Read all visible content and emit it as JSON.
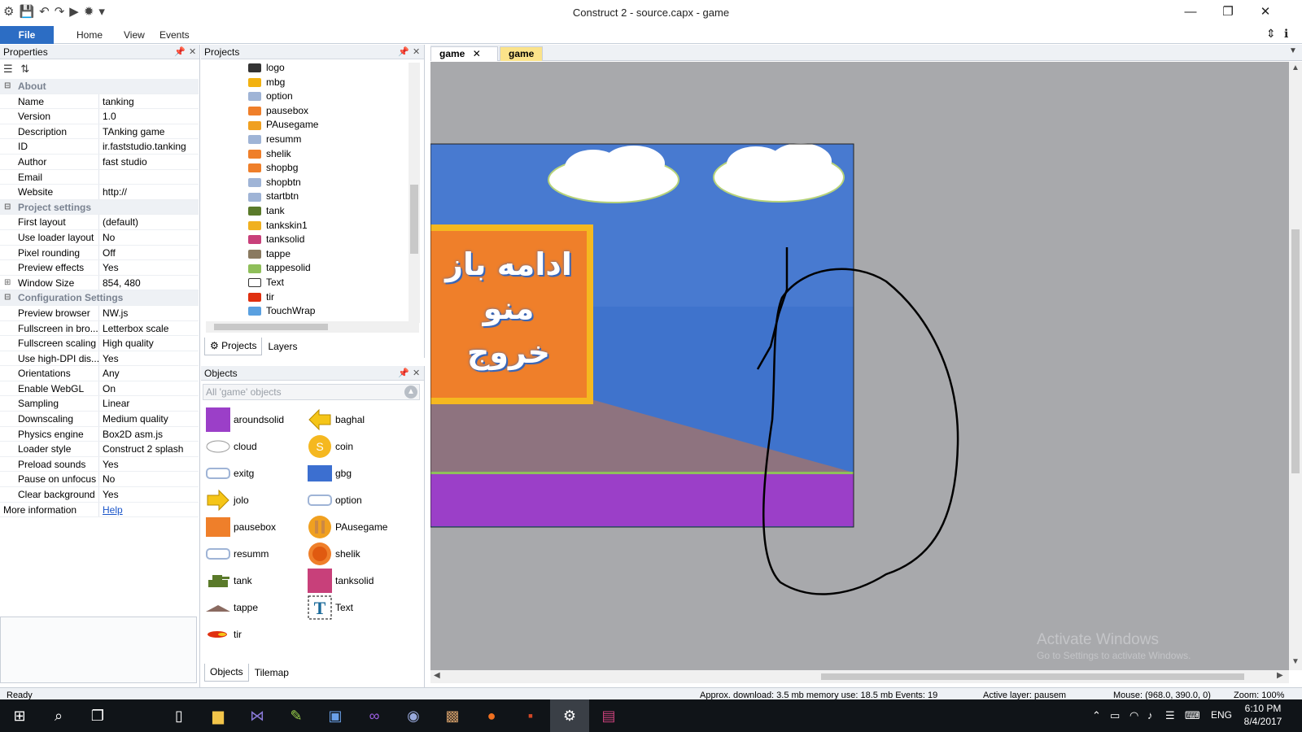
{
  "window": {
    "title": "Construct 2 - source.capx - game",
    "minimize": "—",
    "maximize": "❐",
    "close": "✕"
  },
  "quick_access": [
    "⚙",
    "💾",
    "↶",
    "↷",
    "▶",
    "✹",
    "▾"
  ],
  "ribbon": {
    "tabs": [
      "File",
      "Home",
      "View",
      "Events"
    ],
    "collapse": "⇕",
    "help": "ℹ"
  },
  "properties": {
    "title": "Properties",
    "sections": [
      {
        "label": "About",
        "rows": [
          {
            "k": "Name",
            "v": "tanking"
          },
          {
            "k": "Version",
            "v": "1.0"
          },
          {
            "k": "Description",
            "v": "TAnking game"
          },
          {
            "k": "ID",
            "v": "ir.faststudio.tanking"
          },
          {
            "k": "Author",
            "v": "fast studio"
          },
          {
            "k": "Email",
            "v": ""
          },
          {
            "k": "Website",
            "v": "http://"
          }
        ]
      },
      {
        "label": "Project settings",
        "rows": [
          {
            "k": "First layout",
            "v": "(default)"
          },
          {
            "k": "Use loader layout",
            "v": "No"
          },
          {
            "k": "Pixel rounding",
            "v": "Off"
          },
          {
            "k": "Preview effects",
            "v": "Yes"
          },
          {
            "k": "Window Size",
            "v": "854, 480"
          }
        ]
      },
      {
        "label": "Configuration Settings",
        "rows": [
          {
            "k": "Preview browser",
            "v": "NW.js"
          },
          {
            "k": "Fullscreen in bro...",
            "v": "Letterbox scale"
          },
          {
            "k": "Fullscreen scaling",
            "v": "High quality"
          },
          {
            "k": "Use high-DPI dis...",
            "v": "Yes"
          },
          {
            "k": "Orientations",
            "v": "Any"
          },
          {
            "k": "Enable WebGL",
            "v": "On"
          },
          {
            "k": "Sampling",
            "v": "Linear"
          },
          {
            "k": "Downscaling",
            "v": "Medium quality"
          },
          {
            "k": "Physics engine",
            "v": "Box2D asm.js"
          },
          {
            "k": "Loader style",
            "v": "Construct 2 splash"
          },
          {
            "k": "Preload sounds",
            "v": "Yes"
          },
          {
            "k": "Pause on unfocus",
            "v": "No"
          },
          {
            "k": "Clear background",
            "v": "Yes"
          }
        ]
      }
    ],
    "more_info": {
      "k": "More information",
      "v": "Help"
    }
  },
  "projects": {
    "title": "Projects",
    "items": [
      {
        "label": "logo",
        "color": "#333333"
      },
      {
        "label": "mbg",
        "color": "#f2b211"
      },
      {
        "label": "option",
        "color": "#9fb4d6"
      },
      {
        "label": "pausebox",
        "color": "#ef7f2a"
      },
      {
        "label": "PAusegame",
        "color": "#f0a020"
      },
      {
        "label": "resumm",
        "color": "#9fb4d6"
      },
      {
        "label": "shelik",
        "color": "#ef7f2a"
      },
      {
        "label": "shopbg",
        "color": "#ef7f2a"
      },
      {
        "label": "shopbtn",
        "color": "#9fb4d6"
      },
      {
        "label": "startbtn",
        "color": "#9fb4d6"
      },
      {
        "label": "tank",
        "color": "#5a7a2a"
      },
      {
        "label": "tankskin1",
        "color": "#f0b020"
      },
      {
        "label": "tanksolid",
        "color": "#c8407a"
      },
      {
        "label": "tappe",
        "color": "#8a7a60"
      },
      {
        "label": "tappesolid",
        "color": "#8fbf5a"
      },
      {
        "label": "Text",
        "color": "#ffffff"
      },
      {
        "label": "tir",
        "color": "#e03010"
      },
      {
        "label": "TouchWrap",
        "color": "#5aa0e0"
      }
    ],
    "tabs": [
      "Projects",
      "Layers"
    ]
  },
  "objects": {
    "title": "Objects",
    "filter": "All 'game' objects",
    "items": [
      {
        "label": "aroundsolid",
        "icon": "purple-square-icon",
        "color": "#9b3fc8"
      },
      {
        "label": "baghal",
        "icon": "arrow-left-icon",
        "color": "#f5c518"
      },
      {
        "label": "cloud",
        "icon": "cloud-icon",
        "color": "#ffffff"
      },
      {
        "label": "coin",
        "icon": "coin-icon",
        "color": "#f5b820"
      },
      {
        "label": "exitg",
        "icon": "text-graphic-icon",
        "color": "#9fb4d6"
      },
      {
        "label": "gbg",
        "icon": "blue-rect-icon",
        "color": "#3c6fd0"
      },
      {
        "label": "jolo",
        "icon": "arrow-right-icon",
        "color": "#f5c518"
      },
      {
        "label": "option",
        "icon": "text-graphic-icon",
        "color": "#9fb4d6"
      },
      {
        "label": "pausebox",
        "icon": "orange-rect-icon",
        "color": "#ef7f2a"
      },
      {
        "label": "PAusegame",
        "icon": "pause-icon",
        "color": "#f0a020"
      },
      {
        "label": "resumm",
        "icon": "text-graphic-icon",
        "color": "#9fb4d6"
      },
      {
        "label": "shelik",
        "icon": "fire-button-icon",
        "color": "#ef7f2a"
      },
      {
        "label": "tank",
        "icon": "tank-icon",
        "color": "#5a7a2a"
      },
      {
        "label": "tanksolid",
        "icon": "pink-square-icon",
        "color": "#c8407a"
      },
      {
        "label": "tappe",
        "icon": "hill-icon",
        "color": "#8a6a60"
      },
      {
        "label": "Text",
        "icon": "text-object-icon",
        "color": "#1a6a9a"
      },
      {
        "label": "tir",
        "icon": "bullet-icon",
        "color": "#e03010"
      }
    ],
    "tabs": [
      "Objects",
      "Tilemap"
    ]
  },
  "editor": {
    "tabs": [
      "game",
      "game"
    ],
    "overlay_lines": [
      "ادامه باز",
      "منو",
      "خروج"
    ],
    "watermark": "Activate Windows",
    "watermark_sub": "Go to Settings to activate Windows."
  },
  "status": {
    "ready": "Ready",
    "download": "Approx. download: 3.5 mb  memory use: 18.5 mb  Events: 19",
    "layer": "Active layer: pausem",
    "mouse": "Mouse: (968.0, 390.0, 0)",
    "zoom": "Zoom: 100%"
  },
  "taskbar": {
    "lang": "ENG",
    "time": "6:10 PM",
    "date": "8/4/2017"
  }
}
